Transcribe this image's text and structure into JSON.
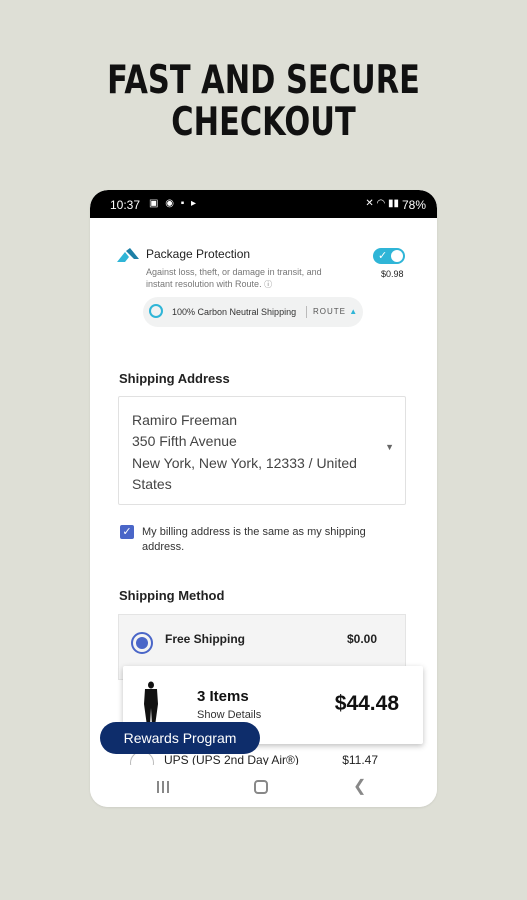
{
  "headline": {
    "line1": "FAST AND SECURE",
    "line2": "CHECKOUT"
  },
  "status_bar": {
    "time": "10:37",
    "battery": "78%"
  },
  "package_protection": {
    "title": "Package Protection",
    "description": "Against loss, theft, or damage in transit, and instant resolution with Route.",
    "toggle_on": true,
    "price": "$0.98",
    "carbon_text": "100% Carbon Neutral Shipping",
    "route_brand": "ROUTE"
  },
  "shipping_address": {
    "title": "Shipping Address",
    "lines": [
      "Ramiro Freeman",
      "350 Fifth Avenue",
      "New York, New York, 12333 / United",
      "States"
    ]
  },
  "billing_checkbox": {
    "checked": true,
    "label": "My billing address is the same as my shipping address."
  },
  "shipping_method": {
    "title": "Shipping Method",
    "options": [
      {
        "name": "Free Shipping",
        "price": "$0.00",
        "selected": true
      },
      {
        "name": "UPS (UPS 2nd Day Air®)",
        "price": "$11.47",
        "selected": false
      }
    ]
  },
  "cart": {
    "items": "3 Items",
    "details": "Show Details",
    "total": "$44.48"
  },
  "rewards_button": {
    "label": "Rewards Program"
  },
  "colors": {
    "accent": "#4a66c8",
    "rewards": "#0e2d6b",
    "toggle": "#2fb5d7",
    "background": "#dedfd6"
  }
}
